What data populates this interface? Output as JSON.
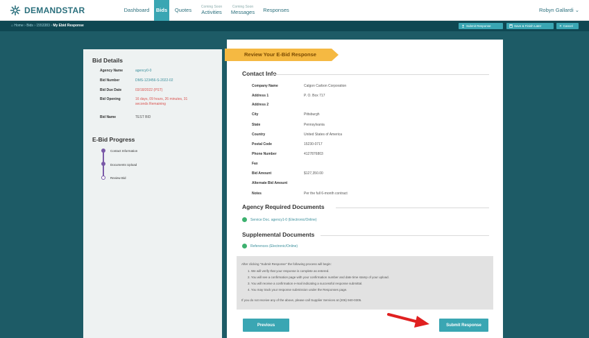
{
  "app": {
    "name": "DEMANDSTAR"
  },
  "nav": [
    {
      "sub": "",
      "label": "Dashboard"
    },
    {
      "sub": "",
      "label": "Bids"
    },
    {
      "sub": "",
      "label": "Quotes"
    },
    {
      "sub": "Coming Soon",
      "label": "Activities"
    },
    {
      "sub": "Coming Soon",
      "label": "Messages"
    },
    {
      "sub": "",
      "label": "Responses"
    }
  ],
  "user": {
    "name": "Robyn Gallardi ⌄"
  },
  "breadcrumb": {
    "home": "⌂ Home",
    "bids": "Bids",
    "bid_id": "1553383",
    "current": "My Ebid Response",
    "sep": "›"
  },
  "actions": {
    "submit": "Submit Response",
    "save": "Save & Finish Later",
    "cancel": "Cancel"
  },
  "bid_details": {
    "title": "Bid Details",
    "rows": [
      {
        "key": "Agency Name",
        "value": "agency0-0",
        "red": false
      },
      {
        "key": "Bid Number",
        "value": "DMS-123456-S-2022-02",
        "red": false
      },
      {
        "key": "Bid Due Date",
        "value": "03/18/2022 (PST)",
        "red": true
      },
      {
        "key": "Bid Opening",
        "value": "16 days, 09 hours, 26 minutes, 31 seconds Remaining",
        "red": true
      },
      {
        "key": "Bid Name",
        "value": "TEST BID",
        "red": false
      }
    ]
  },
  "progress": {
    "title": "E-Bid Progress",
    "steps": [
      "Contact Information",
      "Documents Upload",
      "Review Bid"
    ]
  },
  "review": {
    "banner": "Review Your E-Bid Response"
  },
  "contact_info": {
    "title": "Contact Info",
    "rows": [
      {
        "key": "Company Name",
        "value": "Calgon Carbon Corporation"
      },
      {
        "key": "Address 1",
        "value": "P. O. Box 717"
      },
      {
        "key": "Address 2",
        "value": ""
      },
      {
        "key": "City",
        "value": "Pittsburgh"
      },
      {
        "key": "State",
        "value": "Pennsylvania"
      },
      {
        "key": "Country",
        "value": "United States of America"
      },
      {
        "key": "Postal Code",
        "value": "15230-0717"
      },
      {
        "key": "Phone Number",
        "value": "4127876803"
      },
      {
        "key": "Fax",
        "value": ""
      },
      {
        "key": "Bid Amount",
        "value": "$127,350.00"
      },
      {
        "key": "Alternate Bid Amount",
        "value": ""
      },
      {
        "key": "Notes",
        "value": "Per the full 6-month contract"
      }
    ]
  },
  "agency_docs": {
    "title": "Agency Required Documents",
    "items": [
      "Service Doc. agency1-0 (Electronic/Online)"
    ]
  },
  "supplemental_docs": {
    "title": "Supplemental Documents",
    "items": [
      "References (Electronic/Online)"
    ]
  },
  "info": {
    "intro": "After clicking \"Submit Response\" the following process will begin:",
    "steps": [
      "1. We will verify that your response is complete as entered.",
      "2. You will see a confirmation page with your confirmation number and date time stamp of your upload.",
      "3. You will receive a confirmation e-mail indicating a successful response submittal.",
      "4. You may track your response submission under the Responses page."
    ],
    "footer": "If you do not receive any of the above, please call Supplier Services at (206) 940-0305."
  },
  "buttons": {
    "previous": "Previous",
    "submit": "Submit Response"
  },
  "colors": {
    "brand": "#2a6f7c",
    "accent": "#3aa6b3",
    "background": "#1d5b66",
    "banner": "#f5b942",
    "check": "#3db16f",
    "arrow": "#e02020"
  }
}
